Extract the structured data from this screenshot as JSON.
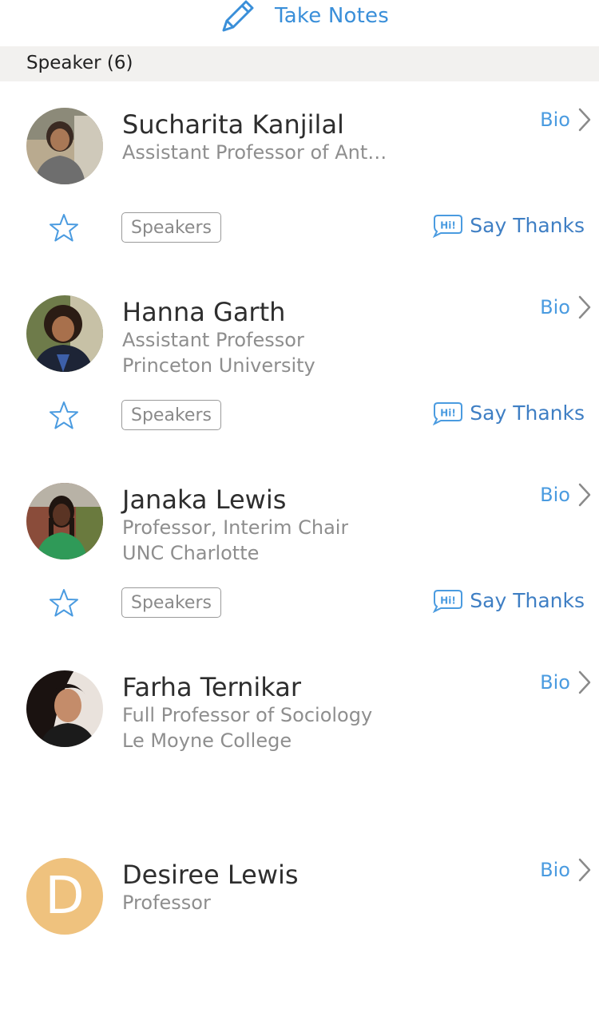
{
  "toolbar": {
    "take_notes_label": "Take Notes",
    "take_notes_icon": "pencil-icon"
  },
  "section": {
    "title": "Speaker (6)"
  },
  "colors": {
    "accent_blue": "#4a9be0",
    "thanks_blue": "#3f7fc4",
    "header_bg": "#f2f1ef",
    "avatar_letter_bg": "#efc27e"
  },
  "speakers": [
    {
      "name": "Sucharita Kanjilal",
      "line1": "Assistant Professor of Ant…",
      "line2": "",
      "bio_label": "Bio",
      "tag": "Speakers",
      "thanks_label": "Say Thanks",
      "hi_badge": "Hi!"
    },
    {
      "name": "Hanna Garth",
      "line1": "Assistant Professor",
      "line2": "Princeton University",
      "bio_label": "Bio",
      "tag": "Speakers",
      "thanks_label": "Say Thanks",
      "hi_badge": "Hi!"
    },
    {
      "name": "Janaka Lewis",
      "line1": "Professor, Interim Chair",
      "line2": "UNC Charlotte",
      "bio_label": "Bio",
      "tag": "Speakers",
      "thanks_label": "Say Thanks",
      "hi_badge": "Hi!"
    },
    {
      "name": "Farha Ternikar",
      "line1": "Full Professor of Sociology",
      "line2": "Le Moyne College",
      "bio_label": "Bio"
    },
    {
      "name": "Desiree Lewis",
      "line1": "Professor",
      "bio_label": "Bio",
      "avatar_letter": "D"
    }
  ]
}
